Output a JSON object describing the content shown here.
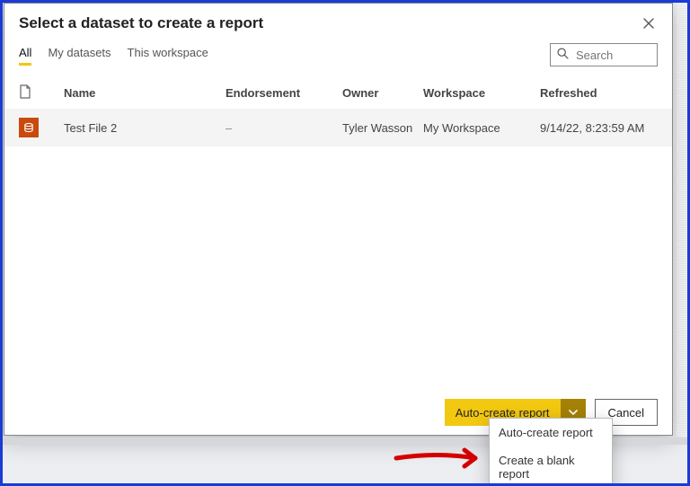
{
  "dialog": {
    "title": "Select a dataset to create a report",
    "close_tooltip": "Close"
  },
  "tabs": {
    "all": "All",
    "my_datasets": "My datasets",
    "this_workspace": "This workspace"
  },
  "search": {
    "placeholder": "Search"
  },
  "columns": {
    "name": "Name",
    "endorsement": "Endorsement",
    "owner": "Owner",
    "workspace": "Workspace",
    "refreshed": "Refreshed"
  },
  "rows": [
    {
      "icon": "dataset-icon",
      "name": "Test File 2",
      "endorsement": "–",
      "owner": "Tyler Wasson",
      "workspace": "My Workspace",
      "refreshed": "9/14/22, 8:23:59 AM"
    }
  ],
  "footer": {
    "primary": "Auto-create report",
    "cancel": "Cancel"
  },
  "dropdown": {
    "auto": "Auto-create report",
    "blank": "Create a blank report"
  }
}
